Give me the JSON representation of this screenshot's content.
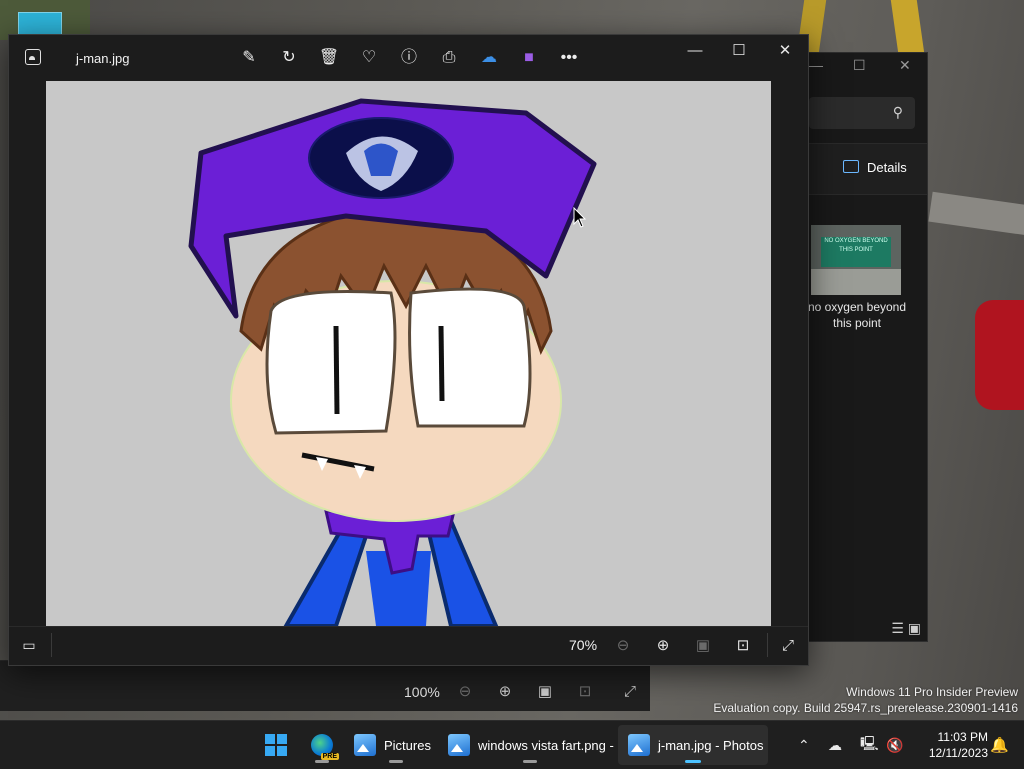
{
  "photos_window": {
    "filename": "j-man.jpg",
    "toolbar": [
      "edit-image",
      "rotate",
      "delete",
      "favorite",
      "file-info",
      "print",
      "onedrive",
      "clipchamp",
      "more"
    ],
    "window_controls": {
      "minimize": "—",
      "maximize": "☐",
      "close": "✕"
    },
    "zoom": "70%",
    "bottom_tools": [
      "filmstrip",
      "zoom-out",
      "zoom-in",
      "fit-to-window",
      "actual-size",
      "full-screen"
    ]
  },
  "back_photos_window": {
    "zoom": "100%"
  },
  "explorer": {
    "details_label": "Details",
    "file_caption": "no oxygen beyond this point",
    "thumb_sign_text": "NO OXYGEN BEYOND THIS POINT"
  },
  "watermark": {
    "line1": "Windows 11 Pro Insider Preview",
    "line2": "Evaluation copy. Build 25947.rs_prerelease.230901-1416"
  },
  "taskbar": {
    "items": [
      {
        "label": "",
        "icon": "start"
      },
      {
        "label": "",
        "icon": "edge-pre"
      },
      {
        "label": "Pictures",
        "icon": "photos"
      },
      {
        "label": "windows vista fart.png -",
        "icon": "photos"
      },
      {
        "label": "j-man.jpg - Photos",
        "icon": "photos",
        "active": true
      }
    ],
    "time": "11:03 PM",
    "date": "12/11/2023"
  },
  "colors": {
    "accent": "#4cc2ff",
    "canvas_bg": "#c8c8c8",
    "hat_purple": "#6b1fd6",
    "shirt_blue": "#1a52e6"
  }
}
